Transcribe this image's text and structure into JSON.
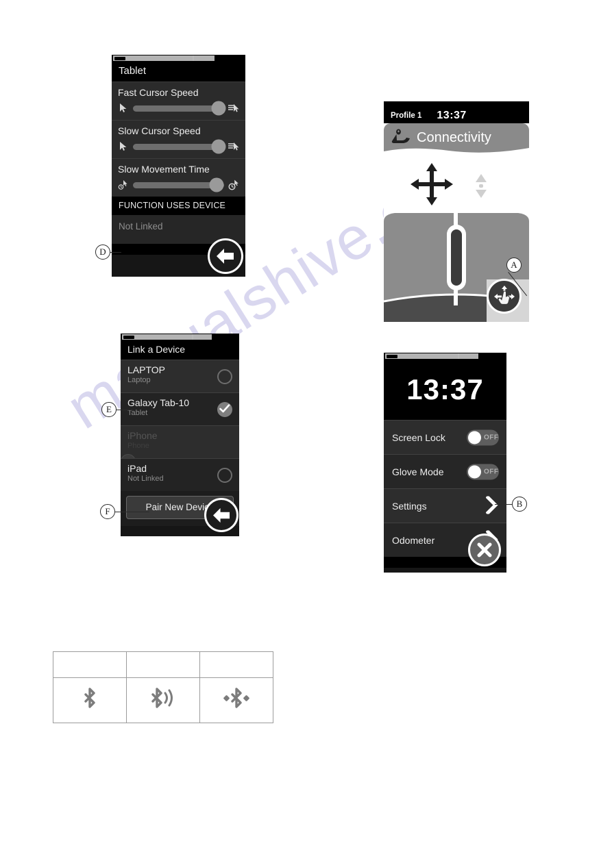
{
  "watermark": {
    "text": "manualshive.com"
  },
  "tablet_screen": {
    "title": "Tablet",
    "sliders": [
      {
        "label": "Fast Cursor Speed",
        "value_pct": 94,
        "left_icon": "cursor-arrow-icon",
        "right_icon": "cursor-fast-icon"
      },
      {
        "label": "Slow Cursor Speed",
        "value_pct": 94,
        "left_icon": "cursor-arrow-icon",
        "right_icon": "cursor-fast-icon"
      },
      {
        "label": "Slow Movement Time",
        "value_pct": 92,
        "left_icon": "clock-cursor-small-icon",
        "right_icon": "clock-cursor-large-icon"
      }
    ],
    "section_header": "FUNCTION USES DEVICE",
    "function_value": "Not Linked",
    "back_button": "back-arrow-icon"
  },
  "link_screen": {
    "title": "Link a Device",
    "devices": [
      {
        "name": "LAPTOP",
        "subtitle": "Laptop",
        "state": "unselected",
        "dimmed": false
      },
      {
        "name": "Galaxy Tab-10",
        "subtitle": "Tablet",
        "state": "selected",
        "dimmed": false
      },
      {
        "name": "iPhone",
        "subtitle": "Phone",
        "state": "blocked",
        "dimmed": true
      },
      {
        "name": "iPad",
        "subtitle": "Not Linked",
        "state": "unselected",
        "dimmed": false
      }
    ],
    "pair_button": "Pair New Device",
    "back_button": "back-arrow-icon"
  },
  "connectivity_screen": {
    "profile": "Profile 1",
    "clock": "13:37",
    "title": "Connectivity",
    "header_icon": "joystick-icon",
    "move_icon": "four-way-arrow-icon",
    "scroll_icon": "scroll-updown-icon",
    "action_button": "pan-hand-icon"
  },
  "home_screen": {
    "clock": "13:37",
    "rows": [
      {
        "label": "Screen Lock",
        "control": "toggle",
        "value": "OFF"
      },
      {
        "label": "Glove Mode",
        "control": "toggle",
        "value": "OFF"
      },
      {
        "label": "Settings",
        "control": "chevron",
        "value": ""
      },
      {
        "label": "Odometer",
        "control": "chevron",
        "value": ""
      }
    ],
    "close_button": "close-x-icon"
  },
  "callouts": [
    {
      "id": "A",
      "target": "connectivity-action-button"
    },
    {
      "id": "B",
      "target": "settings-row-chevron"
    },
    {
      "id": "D",
      "target": "tablet-function-row"
    },
    {
      "id": "E",
      "target": "galaxy-tab-device-row"
    },
    {
      "id": "F",
      "target": "pair-new-device-button"
    }
  ],
  "bt_table": {
    "header_cells": [
      "",
      "",
      ""
    ],
    "icon_cells": [
      "bluetooth-icon",
      "bluetooth-broadcasting-icon",
      "bluetooth-connected-icon"
    ]
  },
  "colors": {
    "screen_bg": "#161616",
    "row_bg": "#2d2d2d",
    "text": "#ededed",
    "muted": "#8c8c8c",
    "watermark": "#c3bfe6",
    "header_grey": "#8a8a8a"
  }
}
